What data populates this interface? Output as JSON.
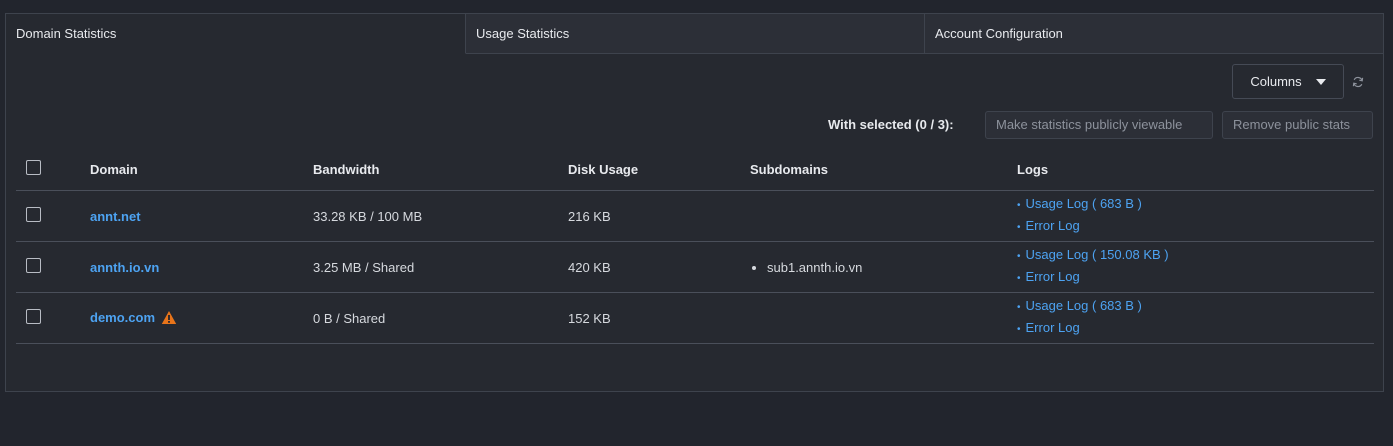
{
  "tabs": [
    {
      "label": "Domain Statistics",
      "active": true
    },
    {
      "label": "Usage Statistics",
      "active": false
    },
    {
      "label": "Account Configuration",
      "active": false
    }
  ],
  "toolbar": {
    "columns_label": "Columns",
    "refresh_icon": "refresh-icon"
  },
  "bulk": {
    "with_selected": "With selected (0 / 3):",
    "public_label": "Make statistics publicly viewable",
    "remove_label": "Remove public stats"
  },
  "table": {
    "headers": {
      "domain": "Domain",
      "bandwidth": "Bandwidth",
      "disk": "Disk Usage",
      "subdomains": "Subdomains",
      "logs": "Logs"
    },
    "rows": [
      {
        "domain": "annt.net",
        "bandwidth": "33.28 KB / 100 MB",
        "disk": "216 KB",
        "subdomain": "",
        "usage_log": "Usage Log ( 683 B )",
        "error_log": "Error Log"
      },
      {
        "domain": "annth.io.vn",
        "bandwidth": "3.25 MB / Shared",
        "disk": "420 KB",
        "subdomain": "sub1.annth.io.vn",
        "usage_log": "Usage Log ( 150.08 KB )",
        "error_log": "Error Log"
      },
      {
        "domain": "demo.com",
        "warning": true,
        "bandwidth": "0 B / Shared",
        "disk": "152 KB",
        "subdomain": "",
        "usage_log": "Usage Log ( 683 B )",
        "error_log": "Error Log"
      }
    ]
  },
  "colors": {
    "link": "#4da3f2",
    "warning": "#e8741a",
    "background": "#22252d"
  }
}
